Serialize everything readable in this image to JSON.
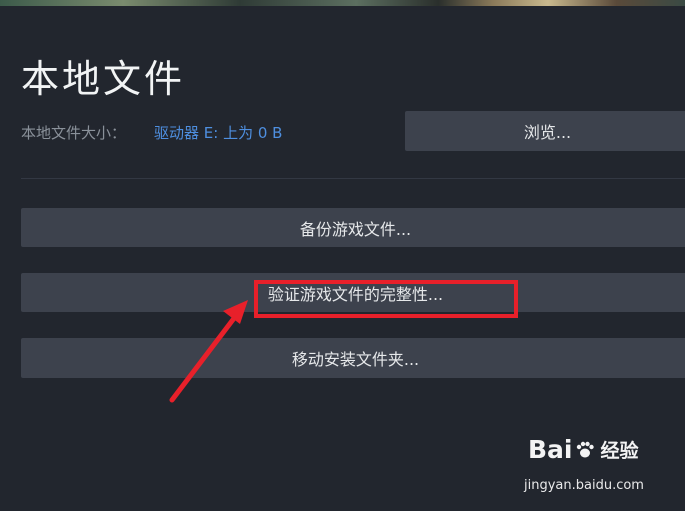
{
  "page": {
    "title": "本地文件"
  },
  "disk": {
    "label": "本地文件大小：",
    "value": "驱动器 E: 上为 0 B"
  },
  "buttons": {
    "browse": "浏览...",
    "backup": "备份游戏文件...",
    "verify": "验证游戏文件的完整性...",
    "move": "移动安装文件夹..."
  },
  "annotation": {
    "color": "#e8202a"
  },
  "watermark": {
    "brand_left": "Bai",
    "brand_right": "经验",
    "url": "jingyan.baidu.com"
  }
}
